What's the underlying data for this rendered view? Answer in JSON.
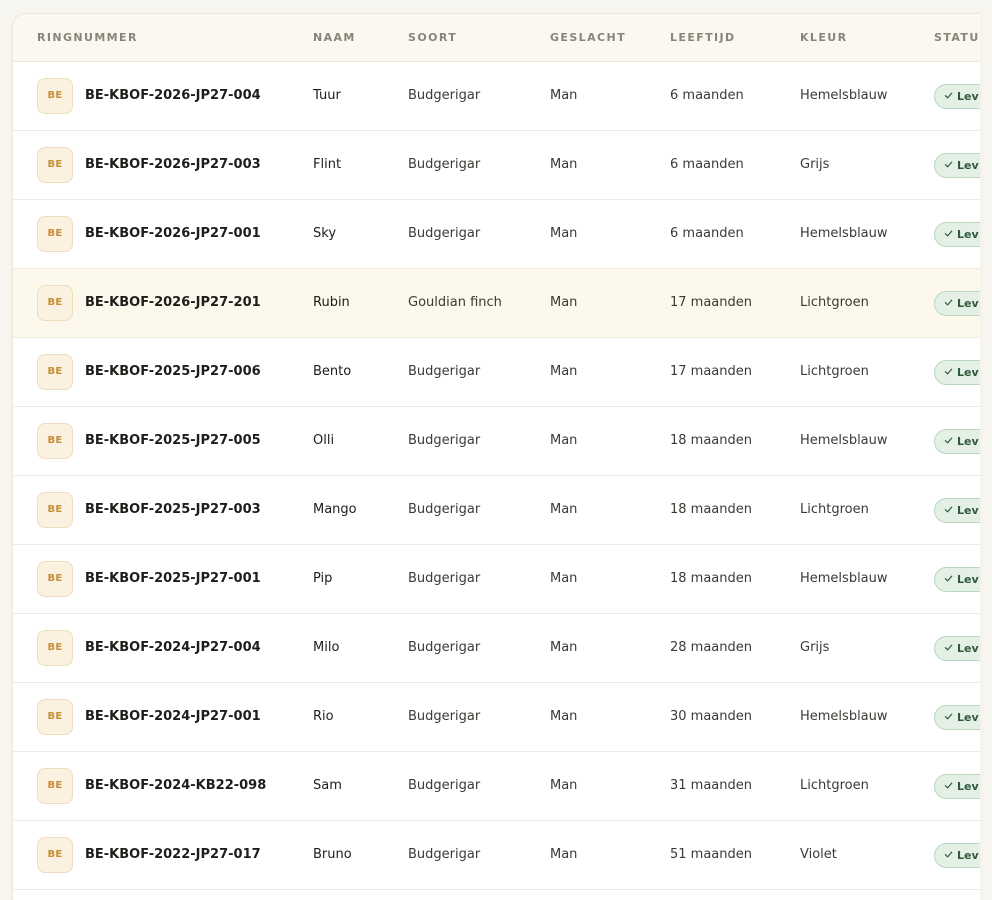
{
  "table": {
    "headers": {
      "ring": "RINGNUMMER",
      "name": "NAAM",
      "species": "SOORT",
      "sex": "GESLACHT",
      "age": "LEEFTIJD",
      "color": "KLEUR",
      "status": "STATUS"
    },
    "rows": [
      {
        "badge": "BE",
        "ring": "BE-KBOF-2026-JP27-004",
        "name": "Tuur",
        "species": "Budgerigar",
        "sex": "Man",
        "age": "6 maanden",
        "color": "Hemelsblauw",
        "status": "Lev"
      },
      {
        "badge": "BE",
        "ring": "BE-KBOF-2026-JP27-003",
        "name": "Flint",
        "species": "Budgerigar",
        "sex": "Man",
        "age": "6 maanden",
        "color": "Grijs",
        "status": "Lev"
      },
      {
        "badge": "BE",
        "ring": "BE-KBOF-2026-JP27-001",
        "name": "Sky",
        "species": "Budgerigar",
        "sex": "Man",
        "age": "6 maanden",
        "color": "Hemelsblauw",
        "status": "Lev"
      },
      {
        "badge": "BE",
        "ring": "BE-KBOF-2026-JP27-201",
        "name": "Rubin",
        "species": "Gouldian finch",
        "sex": "Man",
        "age": "17 maanden",
        "color": "Lichtgroen",
        "status": "Lev"
      },
      {
        "badge": "BE",
        "ring": "BE-KBOF-2025-JP27-006",
        "name": "Bento",
        "species": "Budgerigar",
        "sex": "Man",
        "age": "17 maanden",
        "color": "Lichtgroen",
        "status": "Lev"
      },
      {
        "badge": "BE",
        "ring": "BE-KBOF-2025-JP27-005",
        "name": "Olli",
        "species": "Budgerigar",
        "sex": "Man",
        "age": "18 maanden",
        "color": "Hemelsblauw",
        "status": "Lev"
      },
      {
        "badge": "BE",
        "ring": "BE-KBOF-2025-JP27-003",
        "name": "Mango",
        "species": "Budgerigar",
        "sex": "Man",
        "age": "18 maanden",
        "color": "Lichtgroen",
        "status": "Lev"
      },
      {
        "badge": "BE",
        "ring": "BE-KBOF-2025-JP27-001",
        "name": "Pip",
        "species": "Budgerigar",
        "sex": "Man",
        "age": "18 maanden",
        "color": "Hemelsblauw",
        "status": "Lev"
      },
      {
        "badge": "BE",
        "ring": "BE-KBOF-2024-JP27-004",
        "name": "Milo",
        "species": "Budgerigar",
        "sex": "Man",
        "age": "28 maanden",
        "color": "Grijs",
        "status": "Lev"
      },
      {
        "badge": "BE",
        "ring": "BE-KBOF-2024-JP27-001",
        "name": "Rio",
        "species": "Budgerigar",
        "sex": "Man",
        "age": "30 maanden",
        "color": "Hemelsblauw",
        "status": "Lev"
      },
      {
        "badge": "BE",
        "ring": "BE-KBOF-2024-KB22-098",
        "name": "Sam",
        "species": "Budgerigar",
        "sex": "Man",
        "age": "31 maanden",
        "color": "Lichtgroen",
        "status": "Lev"
      },
      {
        "badge": "BE",
        "ring": "BE-KBOF-2022-JP27-017",
        "name": "Bruno",
        "species": "Budgerigar",
        "sex": "Man",
        "age": "51 maanden",
        "color": "Violet",
        "status": "Lev"
      }
    ],
    "highlighted_row": 3
  },
  "icons": {
    "status": "check-icon"
  },
  "colors": {
    "accent": "#c78e36",
    "status_bg": "#e4f0e6",
    "status_text": "#2f5a3a"
  }
}
